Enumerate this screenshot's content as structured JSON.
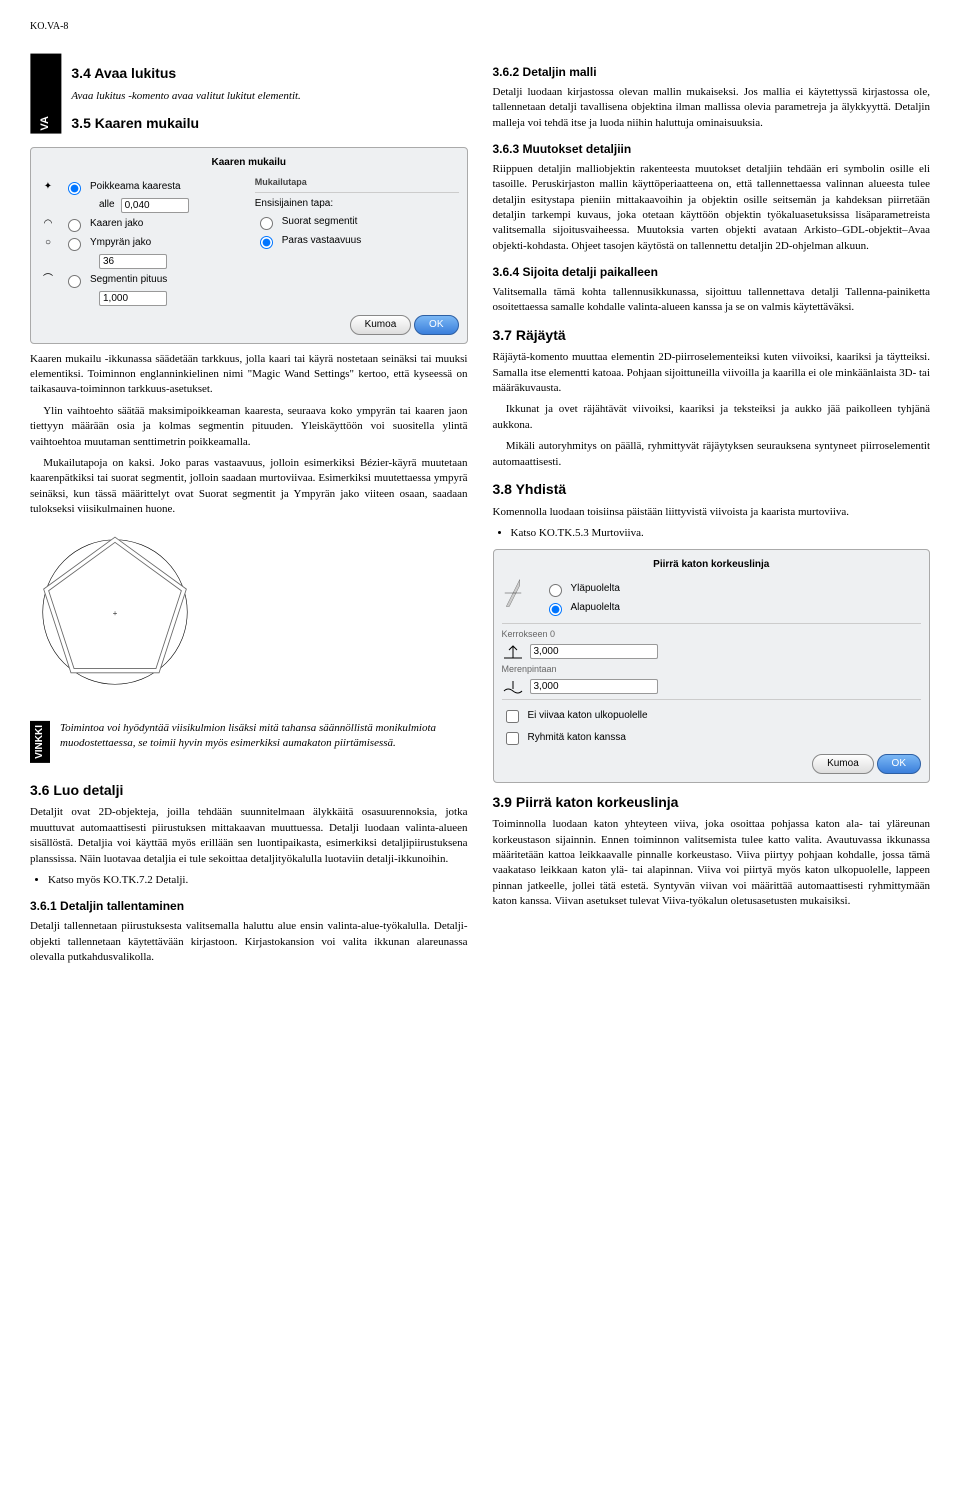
{
  "page_header": "KO.VA-8",
  "side_tab_main": "VA",
  "vinkki_label": "VINKKI",
  "left": {
    "h34": "3.4 Avaa lukitus",
    "p34": "Avaa lukitus -komento avaa valitut lukitut elementit.",
    "h35": "3.5 Kaaren mukailu",
    "p35a": "Kaaren mukailu -ikkunassa säädetään tarkkuus, jolla kaari tai käyrä nostetaan seinäksi tai muuksi elementiksi. Toiminnon englanninkielinen nimi \"Magic Wand Settings\" kertoo, että kyseessä on taikasauva-toiminnon tarkkuus-asetukset.",
    "p35b": "Ylin vaihtoehto säätää maksimipoikkeaman kaaresta, seuraava koko ympyrän tai kaaren jaon tiettyyn määrään osia ja kolmas segmentin pituuden. Yleiskäyttöön voi suositella ylintä vaihtoehtoa muutaman senttimetrin poikkeamalla.",
    "p35c": "Mukailutapoja on kaksi. Joko paras vastaavuus, jolloin esimerkiksi Bézier-käyrä muutetaan kaarenpätkiksi tai suorat segmentit, jolloin saadaan murtoviivaa. Esimerkiksi muutettaessa ympyrä seinäksi, kun tässä määrittelyt ovat Suorat segmentit ja Ympyrän jako viiteen osaan, saadaan tulokseksi viisikulmainen huone.",
    "vinkki": "Toimintoa voi hyödyntää viisikulmion lisäksi mitä tahansa säännöllistä monikulmiota muodostettaessa, se toimii hyvin myös esimerkiksi aumakaton piirtämisessä.",
    "h36": "3.6 Luo detalji",
    "p36": "Detaljit ovat 2D-objekteja, joilla tehdään suunnitelmaan älykkäitä osasuurennoksia, jotka muuttuvat automaattisesti piirustuksen mittakaavan muuttuessa. Detalji luodaan valinta-alueen sisällöstä. Detaljia voi käyttää myös erillään sen luontipaikasta, esimerkiksi detaljipiirustuksena planssissa. Näin luotavaa detaljia ei tule sekoittaa detaljityökalulla luotaviin detalji-ikkunoihin.",
    "li36": "Katso myös KO.TK.7.2 Detalji.",
    "h361": "3.6.1 Detaljin tallentaminen",
    "p361": "Detalji tallennetaan piirustuksesta valitsemalla haluttu alue ensin valinta-alue-työkalulla. Detalji-objekti tallennetaan käytettävään kirjastoon. Kirjastokansion voi valita ikkunan alareunassa olevalla putkahdusvalikolla."
  },
  "right": {
    "h362": "3.6.2 Detaljin malli",
    "p362": "Detalji luodaan kirjastossa olevan mallin mukaiseksi. Jos mallia ei käytettyssä kirjastossa ole, tallennetaan detalji tavallisena objektina ilman mallissa olevia parametreja ja älykkyyttä. Detaljin malleja voi tehdä itse ja luoda niihin haluttuja ominaisuuksia.",
    "h363": "3.6.3 Muutokset detaljiin",
    "p363": "Riippuen detaljin malliobjektin rakenteesta muutokset detaljiin tehdään eri symbolin osille eli tasoille. Peruskirjaston mallin käyttöperiaatteena on, että tallennettaessa valinnan alueesta tulee detaljin esitystapa pieniin mittakaavoihin ja objektin osille seitsemän ja kahdeksan piirretään detaljin tarkempi kuvaus, joka otetaan käyttöön objektin työkaluasetuksissa lisäparametreista valitsemalla sijoitusvaiheessa. Muutoksia varten objekti avataan Arkisto–GDL-objektit–Avaa objekti-kohdasta. Ohjeet tasojen käytöstä on tallennettu detaljin 2D-ohjelman alkuun.",
    "h364": "3.6.4 Sijoita detalji paikalleen",
    "p364": "Valitsemalla tämä kohta tallennusikkunassa, sijoittuu tallennettava detalji Tallenna-painiketta osoitettaessa samalle kohdalle valinta-alueen kanssa ja se on valmis käytettäväksi.",
    "h37": "3.7 Räjäytä",
    "p37a": "Räjäytä-komento muuttaa elementin 2D-piirroselementeiksi kuten viivoiksi, kaariksi ja täytteiksi. Samalla itse elementti katoaa. Pohjaan sijoittuneilla viivoilla ja kaarilla ei ole minkäänlaista 3D- tai määräkuvausta.",
    "p37b": "Ikkunat ja ovet räjähtävät viivoiksi, kaariksi ja teksteiksi ja aukko jää paikolleen tyhjänä aukkona.",
    "p37c": "Mikäli autoryhmitys on päällä, ryhmittyvät räjäytyksen seurauksena syntyneet piirroselementit automaattisesti.",
    "h38": "3.8 Yhdistä",
    "p38": "Komennolla luodaan toisiinsa päistään liittyvistä viivoista ja kaarista murtoviiva.",
    "li38": "Katso KO.TK.5.3 Murtoviiva.",
    "h39": "3.9 Piirrä katon korkeuslinja",
    "p39": "Toiminnolla luodaan katon yhteyteen viiva, joka osoittaa pohjassa katon ala- tai yläreunan korkeustason sijainnin. Ennen toiminnon valitsemista tulee katto valita. Avautuvassa ikkunassa määritetään kattoa leikkaavalle pinnalle korkeustaso. Viiva piirtyy pohjaan kohdalle, jossa tämä vaakataso leikkaan katon ylä- tai alapinnan. Viiva voi piirtyä myös katon ulkopuolelle, lappeen pinnan jatkeelle, jollei tätä estetä. Syntyvän viivan voi määrittää automaattisesti ryhmittymään katon kanssa. Viivan asetukset tulevat Viiva-työkalun oletusasetusten mukaisiksi."
  },
  "dialog1": {
    "title": "Kaaren mukailu",
    "section_mukailutapa": "Mukailutapa",
    "ensisijainen": "Ensisijainen tapa:",
    "opt_poikkeama": "Poikkeama kaaresta",
    "alle": "alle",
    "val_alle": "0,040",
    "opt_kaaren": "Kaaren jako",
    "opt_ympyran": "Ympyrän jako",
    "val_jako": "36",
    "opt_segmentin": "Segmentin pituus",
    "val_seg": "1,000",
    "opt_suorat": "Suorat segmentit",
    "opt_paras": "Paras vastaavuus",
    "btn_kumoa": "Kumoa",
    "btn_ok": "OK"
  },
  "dialog2": {
    "title": "Piirrä katon korkeuslinja",
    "opt_yla": "Yläpuolelta",
    "opt_ala": "Alapuolelta",
    "lbl_kerros": "Kerrokseen 0",
    "val_kerros": "3,000",
    "lbl_meren": "Merenpintaan",
    "val_meren": "3,000",
    "chk_ei": "Ei viivaa katon ulkopuolelle",
    "chk_ryhm": "Ryhmitä katon kanssa",
    "btn_kumoa": "Kumoa",
    "btn_ok": "OK"
  }
}
